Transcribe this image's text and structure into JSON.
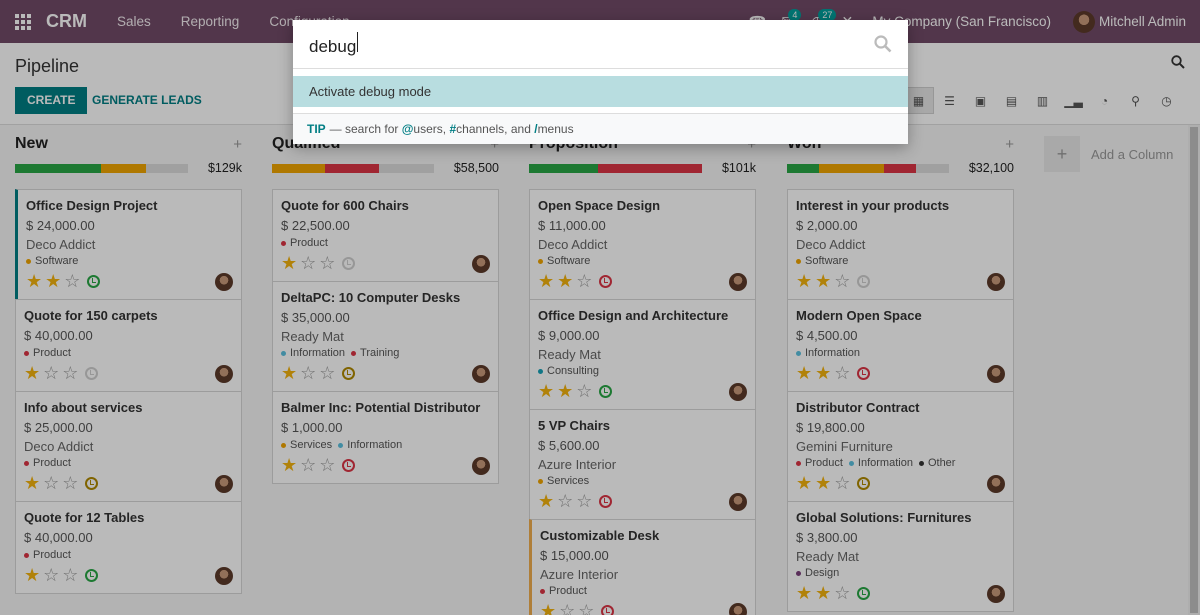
{
  "navbar": {
    "brand": "CRM",
    "menus": [
      "Sales",
      "Reporting",
      "Configuration"
    ],
    "badge_messages": "4",
    "badge_activities": "27",
    "company": "My Company (San Francisco)",
    "user": "Mitchell Admin",
    "color": "#714b67"
  },
  "control": {
    "title": "Pipeline",
    "create_label": "CREATE",
    "generate_label": "GENERATE LEADS",
    "views": [
      "kanban-icon",
      "list-icon",
      "calendar-icon",
      "pivot-icon",
      "graph-icon",
      "cohort-icon",
      "dashboard-icon",
      "map-icon",
      "activity-icon"
    ],
    "accent": "#017e84"
  },
  "palette": {
    "query": "debug",
    "result": "Activate debug mode",
    "tip_label": "TIP",
    "tip_text_1": "— search for ",
    "tip_mark_users": "@",
    "tip_text_2": "users, ",
    "tip_mark_channels": "#",
    "tip_text_3": "channels, and ",
    "tip_mark_menus": "/",
    "tip_text_4": "menus"
  },
  "kanban": {
    "add_column": "Add a Column",
    "columns": [
      {
        "title": "New",
        "sum": "$129k",
        "progress": [
          {
            "color": "#28a745",
            "pct": 50
          },
          {
            "color": "#f0a500",
            "pct": 26
          }
        ],
        "cards": [
          {
            "title": "Office Design Project",
            "amount": "$ 24,000.00",
            "partner": "Deco Addict",
            "tags": [
              {
                "label": "Software",
                "color": "#f0a500"
              }
            ],
            "stars": 2,
            "clock": "green"
          },
          {
            "title": "Quote for 150 carpets",
            "amount": "$ 40,000.00",
            "partner": "",
            "tags": [
              {
                "label": "Product",
                "color": "#dc3545"
              }
            ],
            "stars": 1,
            "clock": "grey"
          },
          {
            "title": "Info about services",
            "amount": "$ 25,000.00",
            "partner": "Deco Addict",
            "tags": [
              {
                "label": "Product",
                "color": "#dc3545"
              }
            ],
            "stars": 1,
            "clock": "amber"
          },
          {
            "title": "Quote for 12 Tables",
            "amount": "$ 40,000.00",
            "partner": "",
            "tags": [
              {
                "label": "Product",
                "color": "#dc3545"
              }
            ],
            "stars": 1,
            "clock": "green"
          }
        ]
      },
      {
        "title": "Qualified",
        "sum": "$58,500",
        "progress": [
          {
            "color": "#f0a500",
            "pct": 33
          },
          {
            "color": "#dc3545",
            "pct": 33
          }
        ],
        "cards": [
          {
            "title": "Quote for 600 Chairs",
            "amount": "$ 22,500.00",
            "partner": "",
            "tags": [
              {
                "label": "Product",
                "color": "#dc3545"
              }
            ],
            "stars": 1,
            "clock": "grey"
          },
          {
            "title": "DeltaPC: 10 Computer Desks",
            "amount": "$ 35,000.00",
            "partner": "Ready Mat",
            "tags": [
              {
                "label": "Information",
                "color": "#5bc0de"
              },
              {
                "label": "Training",
                "color": "#dc3545"
              }
            ],
            "stars": 1,
            "clock": "amber"
          },
          {
            "title": "Balmer Inc: Potential Distributor",
            "amount": "$ 1,000.00",
            "partner": "",
            "tags": [
              {
                "label": "Services",
                "color": "#f0a500"
              },
              {
                "label": "Information",
                "color": "#5bc0de"
              }
            ],
            "stars": 1,
            "clock": "red"
          }
        ]
      },
      {
        "title": "Proposition",
        "sum": "$101k",
        "progress": [
          {
            "color": "#28a745",
            "pct": 40
          },
          {
            "color": "#dc3545",
            "pct": 60
          }
        ],
        "cards": [
          {
            "title": "Open Space Design",
            "amount": "$ 11,000.00",
            "partner": "Deco Addict",
            "tags": [
              {
                "label": "Software",
                "color": "#f0a500"
              }
            ],
            "stars": 2,
            "clock": "red"
          },
          {
            "title": "Office Design and Architecture",
            "amount": "$ 9,000.00",
            "partner": "Ready Mat",
            "tags": [
              {
                "label": "Consulting",
                "color": "#17a2b8"
              }
            ],
            "stars": 2,
            "clock": "green"
          },
          {
            "title": "5 VP Chairs",
            "amount": "$ 5,600.00",
            "partner": "Azure Interior",
            "tags": [
              {
                "label": "Services",
                "color": "#f0a500"
              }
            ],
            "stars": 1,
            "clock": "red"
          },
          {
            "title": "Customizable Desk",
            "amount": "$ 15,000.00",
            "partner": "Azure Interior",
            "tags": [
              {
                "label": "Product",
                "color": "#dc3545"
              }
            ],
            "stars": 1,
            "clock": "red"
          }
        ]
      },
      {
        "title": "Won",
        "sum": "$32,100",
        "progress": [
          {
            "color": "#28a745",
            "pct": 20
          },
          {
            "color": "#f0a500",
            "pct": 40
          },
          {
            "color": "#dc3545",
            "pct": 20
          }
        ],
        "cards": [
          {
            "title": "Interest in your products",
            "amount": "$ 2,000.00",
            "partner": "Deco Addict",
            "tags": [
              {
                "label": "Software",
                "color": "#f0a500"
              }
            ],
            "stars": 2,
            "clock": "grey"
          },
          {
            "title": "Modern Open Space",
            "amount": "$ 4,500.00",
            "partner": "",
            "tags": [
              {
                "label": "Information",
                "color": "#5bc0de"
              }
            ],
            "stars": 2,
            "clock": "red"
          },
          {
            "title": "Distributor Contract",
            "amount": "$ 19,800.00",
            "partner": "Gemini Furniture",
            "tags": [
              {
                "label": "Product",
                "color": "#dc3545"
              },
              {
                "label": "Information",
                "color": "#5bc0de"
              },
              {
                "label": "Other",
                "color": "#333333"
              }
            ],
            "stars": 2,
            "clock": "amber"
          },
          {
            "title": "Global Solutions: Furnitures",
            "amount": "$ 3,800.00",
            "partner": "Ready Mat",
            "tags": [
              {
                "label": "Design",
                "color": "#7b3f7b"
              }
            ],
            "stars": 2,
            "clock": "green"
          }
        ]
      }
    ]
  }
}
